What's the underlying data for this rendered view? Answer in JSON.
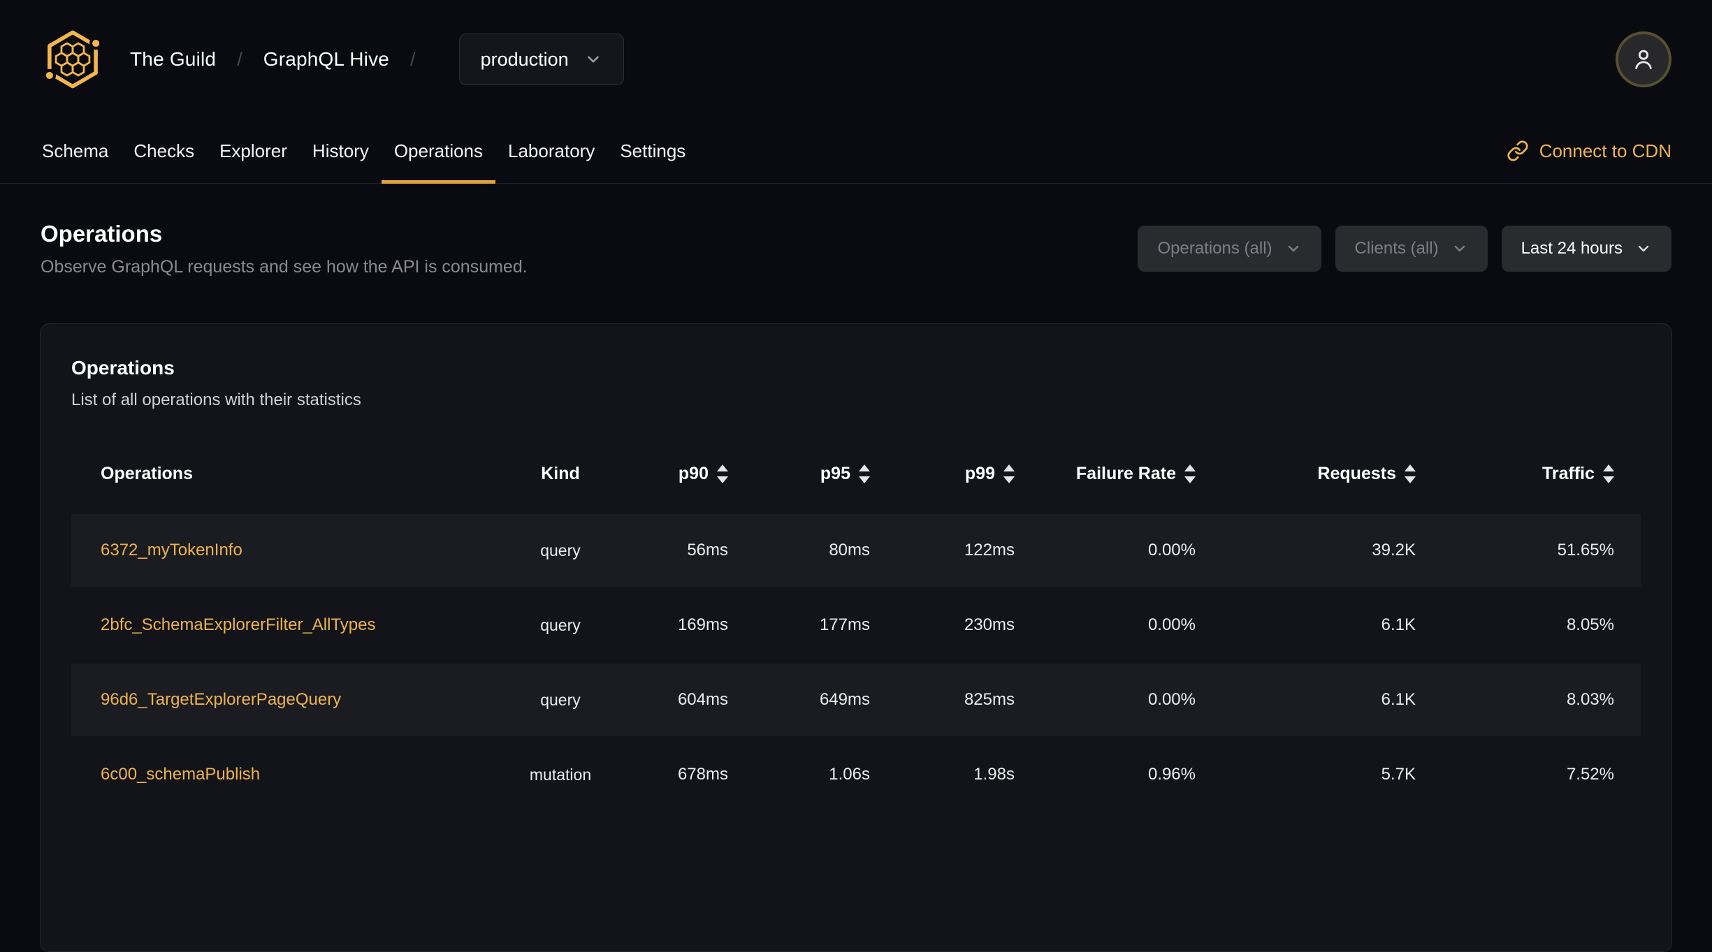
{
  "topbar": {
    "org": "The Guild",
    "project": "GraphQL Hive",
    "separator": "/",
    "target_dropdown": {
      "value": "production"
    }
  },
  "nav": {
    "tabs": [
      {
        "label": "Schema",
        "active": false
      },
      {
        "label": "Checks",
        "active": false
      },
      {
        "label": "Explorer",
        "active": false
      },
      {
        "label": "History",
        "active": false
      },
      {
        "label": "Operations",
        "active": true
      },
      {
        "label": "Laboratory",
        "active": false
      },
      {
        "label": "Settings",
        "active": false
      }
    ],
    "cdn_link": {
      "label": "Connect to CDN"
    }
  },
  "page_header": {
    "title": "Operations",
    "subtitle": "Observe GraphQL requests and see how the API is consumed."
  },
  "filters": {
    "operations": {
      "label": "Operations (all)",
      "enabled": false
    },
    "clients": {
      "label": "Clients (all)",
      "enabled": false
    },
    "period": {
      "label": "Last 24 hours",
      "enabled": true
    }
  },
  "card": {
    "title": "Operations",
    "subtitle": "List of all operations with their statistics"
  },
  "table": {
    "columns": [
      {
        "key": "operation",
        "label": "Operations",
        "align": "left",
        "sortable": false
      },
      {
        "key": "kind",
        "label": "Kind",
        "align": "center",
        "sortable": false
      },
      {
        "key": "p90",
        "label": "p90",
        "align": "right",
        "sortable": true
      },
      {
        "key": "p95",
        "label": "p95",
        "align": "right",
        "sortable": true
      },
      {
        "key": "p99",
        "label": "p99",
        "align": "right",
        "sortable": true
      },
      {
        "key": "failure_rate",
        "label": "Failure Rate",
        "align": "right",
        "sortable": true
      },
      {
        "key": "requests",
        "label": "Requests",
        "align": "right",
        "sortable": true
      },
      {
        "key": "traffic",
        "label": "Traffic",
        "align": "right",
        "sortable": true
      }
    ],
    "rows": [
      {
        "operation": "6372_myTokenInfo",
        "kind": "query",
        "p90": "56ms",
        "p95": "80ms",
        "p99": "122ms",
        "failure_rate": "0.00%",
        "requests": "39.2K",
        "traffic": "51.65%"
      },
      {
        "operation": "2bfc_SchemaExplorerFilter_AllTypes",
        "kind": "query",
        "p90": "169ms",
        "p95": "177ms",
        "p99": "230ms",
        "failure_rate": "0.00%",
        "requests": "6.1K",
        "traffic": "8.05%"
      },
      {
        "operation": "96d6_TargetExplorerPageQuery",
        "kind": "query",
        "p90": "604ms",
        "p95": "649ms",
        "p99": "825ms",
        "failure_rate": "0.00%",
        "requests": "6.1K",
        "traffic": "8.03%"
      },
      {
        "operation": "6c00_schemaPublish",
        "kind": "mutation",
        "p90": "678ms",
        "p95": "1.06s",
        "p99": "1.98s",
        "failure_rate": "0.96%",
        "requests": "5.7K",
        "traffic": "7.52%"
      }
    ]
  },
  "colors": {
    "accent_gold": "#efb44e",
    "active_tab_underline": "#dfa43e",
    "page_background": "#090b10",
    "card_background": "#131419",
    "row_stripe": "#1b1c21"
  }
}
